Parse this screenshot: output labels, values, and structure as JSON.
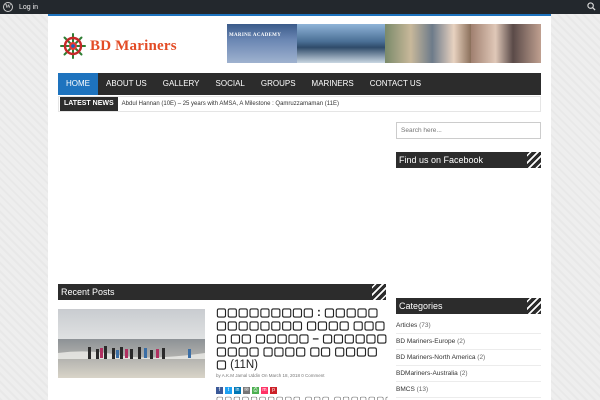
{
  "admin_bar": {
    "wp_icon": "wordpress-icon",
    "login_label": "Log in",
    "search_icon": "search-icon"
  },
  "header": {
    "logo_text": "BD Mariners",
    "banner_text": "MARINE ACADEMY"
  },
  "nav": {
    "items": [
      {
        "label": "HOME",
        "active": true
      },
      {
        "label": "ABOUT US",
        "active": false
      },
      {
        "label": "GALLERY",
        "active": false
      },
      {
        "label": "SOCIAL",
        "active": false
      },
      {
        "label": "GROUPS",
        "active": false
      },
      {
        "label": "MARINERS",
        "active": false
      },
      {
        "label": "CONTACT US",
        "active": false
      }
    ]
  },
  "ticker": {
    "label": "LATEST NEWS",
    "text": "Abdul Hannan (10E) – 25 years with AMSA, A Milestone : Qamruzzamaman (11E)"
  },
  "sidebar": {
    "search_placeholder": "Search here...",
    "facebook_title": "Find us on Facebook",
    "categories_title": "Categories",
    "categories": [
      {
        "name": "Articles",
        "count": "(73)"
      },
      {
        "name": "BD Mariners-Europe",
        "count": "(2)"
      },
      {
        "name": "BD Mariners-North America",
        "count": "(2)"
      },
      {
        "name": "BDMariners-Australia",
        "count": "(2)"
      },
      {
        "name": "BMCS",
        "count": "(13)"
      }
    ]
  },
  "recent": {
    "title": "Recent Posts",
    "post": {
      "title": "▢▢▢▢▢▢▢▢▢ : ▢▢▢▢▢▢▢▢▢▢▢▢▢ ▢▢▢▢ ▢▢▢▢ ▢▢ ▢▢▢▢▢ – ▢▢▢▢▢▢▢▢▢▢ ▢▢▢▢ ▢▢ ▢▢▢▢▢",
      "batch": "(11N)",
      "meta": "by A.K.M Jamal Uddin On March 18, 2018 0 Comment",
      "excerpt": "▢▢▢▢▢▢▢▢▢▢ ▢▢▢ ▢▢▢▢▢▢▢▢▢▢▢"
    },
    "share_colors": [
      "#3b5998",
      "#1da1f2",
      "#0077b5",
      "#777777",
      "#4caf50",
      "#ff3366",
      "#cb2027"
    ]
  },
  "colors": {
    "accent": "#1e73be",
    "dark": "#2c2c2c",
    "logo": "#e34c26"
  }
}
